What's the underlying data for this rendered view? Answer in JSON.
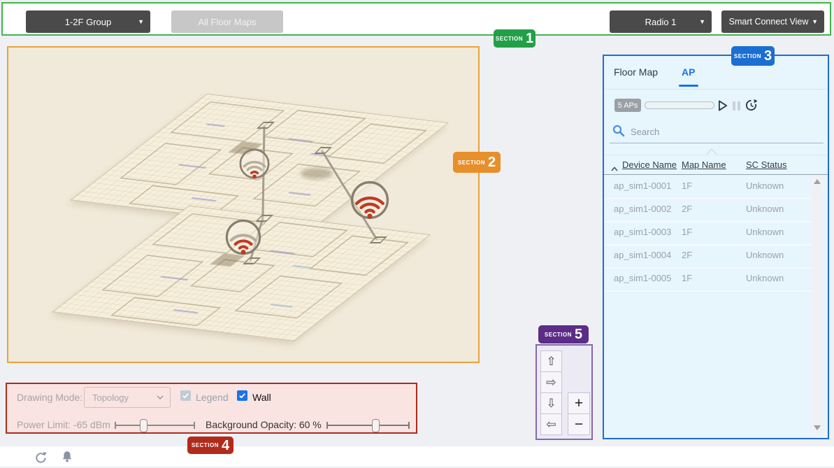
{
  "header": {
    "caret": "▼",
    "group_dropdown": "1-2F Group",
    "all_floor_maps": "All Floor Maps",
    "radio_dropdown": "Radio 1",
    "view_dropdown": "Smart Connect View"
  },
  "sections": {
    "s1": {
      "label": "SECTION",
      "num": "1"
    },
    "s2": {
      "label": "SECTION",
      "num": "2"
    },
    "s3": {
      "label": "SECTION",
      "num": "3"
    },
    "s4": {
      "label": "SECTION",
      "num": "4"
    },
    "s5": {
      "label": "SECTION",
      "num": "5"
    }
  },
  "panel": {
    "tabs": {
      "floor_map": "Floor Map",
      "ap": "AP"
    },
    "ap_count": "5 APs",
    "search_placeholder": "Search",
    "table": {
      "col_device": "Device Name",
      "col_map": "Map Name",
      "col_status": "SC Status",
      "rows": [
        {
          "device": "ap_sim1-0001",
          "map": "1F",
          "status": "Unknown"
        },
        {
          "device": "ap_sim1-0002",
          "map": "2F",
          "status": "Unknown"
        },
        {
          "device": "ap_sim1-0003",
          "map": "1F",
          "status": "Unknown"
        },
        {
          "device": "ap_sim1-0004",
          "map": "2F",
          "status": "Unknown"
        },
        {
          "device": "ap_sim1-0005",
          "map": "1F",
          "status": "Unknown"
        }
      ]
    }
  },
  "controls": {
    "drawing_mode_label": "Drawing Mode:",
    "drawing_mode_value": "Topology",
    "legend": "Legend",
    "wall": "Wall",
    "power_limit": "Power Limit: -65 dBm",
    "background_opacity": "Background Opacity: 60 %"
  },
  "pan_zoom": {
    "up": "⇧",
    "right": "⇨",
    "down": "⇩",
    "left": "⇦",
    "zoom_in": "+",
    "zoom_out": "−"
  },
  "colors": {
    "accent_green": "#43b34d",
    "accent_orange": "#e9a33b",
    "accent_blue": "#1b6ed2",
    "accent_red": "#b12a1c",
    "accent_purple": "#5c2d87",
    "tab_active_blue": "#1a73e8",
    "wifi_active_red": "#bf3a22",
    "wifi_inactive": "#b7ae9c"
  }
}
